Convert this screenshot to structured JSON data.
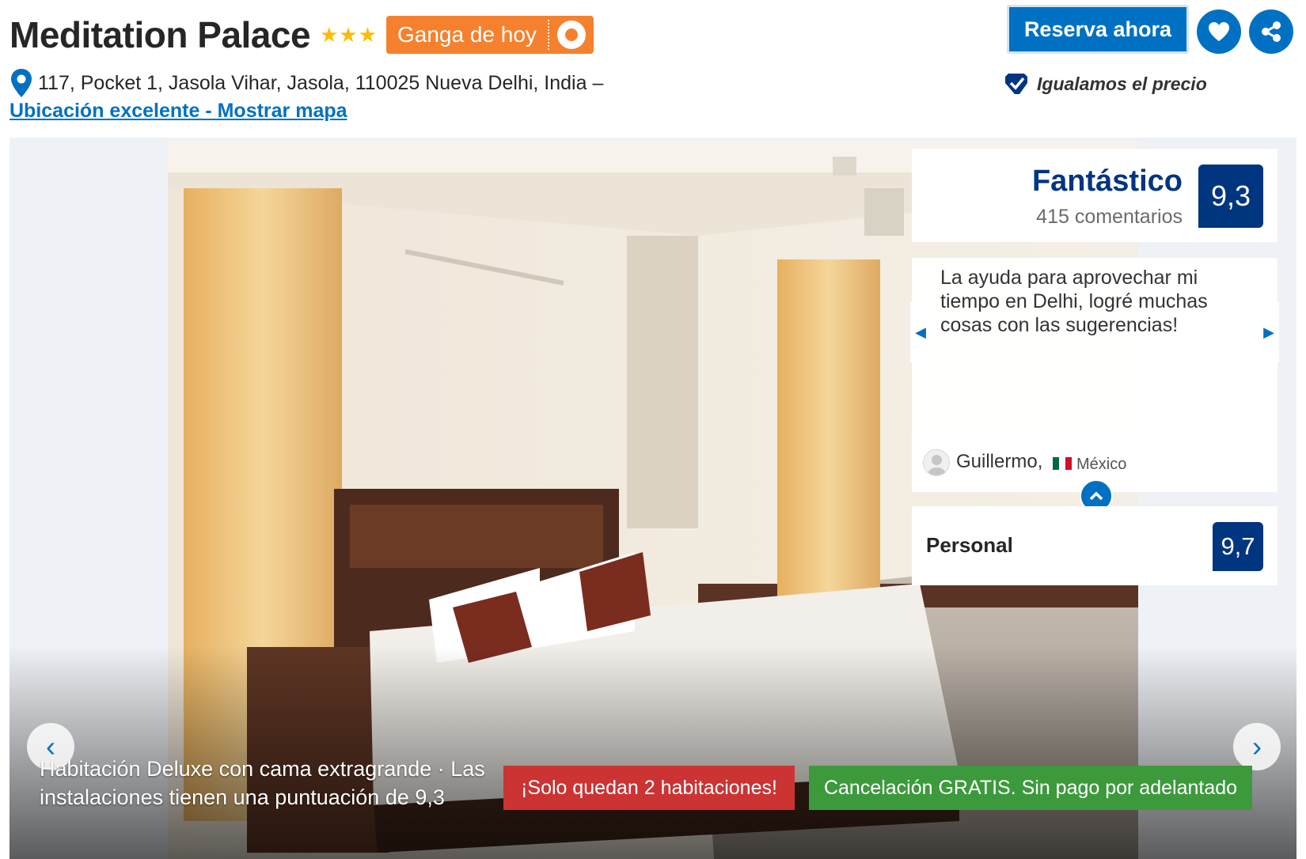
{
  "header": {
    "hotel_name": "Meditation Palace",
    "stars": 3,
    "deal_badge": "Ganga de hoy",
    "address": "117, Pocket 1, Jasola Vihar, Jasola, 110025 Nueva Delhi, India –",
    "map_link": "Ubicación excelente - Mostrar mapa"
  },
  "actions": {
    "reserve_label": "Reserva ahora",
    "price_match": "Igualamos el precio"
  },
  "gallery": {
    "caption": "Habitación Deluxe con cama extragrande · Las instalaciones tienen una puntuación de 9,3",
    "rooms_left": "¡Solo quedan 2 habitaciones!",
    "free_cancellation": "Cancelación GRATIS. Sin pago por adelantado"
  },
  "rating": {
    "word": "Fantástico",
    "reviews_count": "415 comentarios",
    "score": "9,3"
  },
  "review": {
    "text": "La ayuda para aprovechar mi tiempo en Delhi, logré muchas cosas con las sugerencias!",
    "reviewer": "Guillermo,",
    "country": "México"
  },
  "category": {
    "label": "Personal",
    "score": "9,7"
  },
  "colors": {
    "primary_blue": "#0071c2",
    "dark_blue": "#003580",
    "deal_orange": "#f5812f",
    "star_yellow": "#febb02",
    "urgency_red": "#cc3333",
    "success_green": "#3c9a3c"
  },
  "icons": [
    "map-pin-icon",
    "star-icon",
    "lightbulb-icon",
    "heart-icon",
    "share-icon",
    "checkmark-icon",
    "chevron-left-icon",
    "chevron-right-icon",
    "chevron-up-icon",
    "avatar-icon",
    "mexico-flag-icon"
  ]
}
